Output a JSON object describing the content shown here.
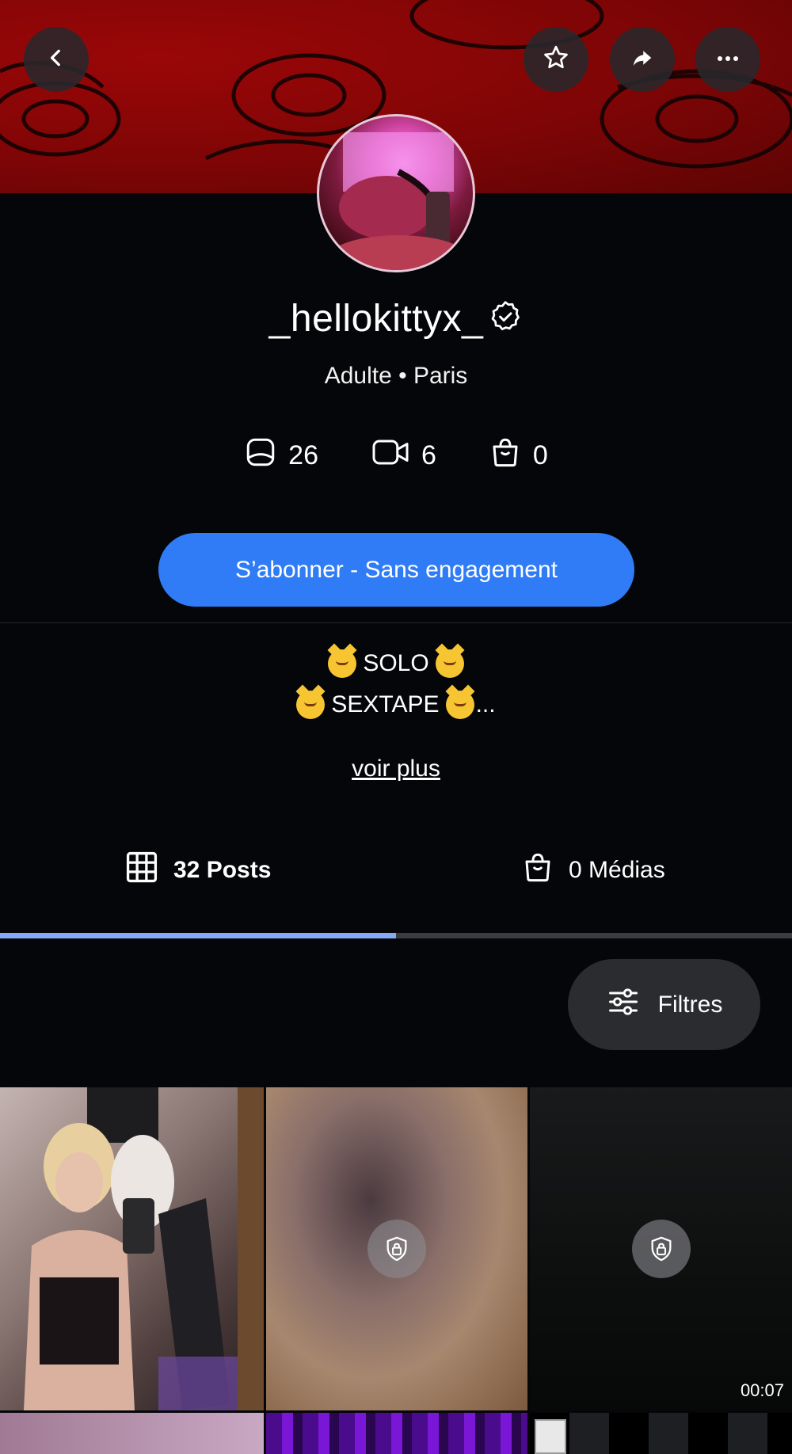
{
  "header": {
    "back_icon": "chevron-left-icon",
    "favorite_icon": "star-icon",
    "share_icon": "share-arrow-icon",
    "more_icon": "ellipsis-icon"
  },
  "profile": {
    "username": "_hellokittyx_",
    "verified_icon": "verified-badge-icon",
    "subtitle": "Adulte • Paris",
    "stats": [
      {
        "icon": "photo-icon",
        "value": "26"
      },
      {
        "icon": "video-icon",
        "value": "6"
      },
      {
        "icon": "shopping-bag-icon",
        "value": "0"
      }
    ]
  },
  "subscribe": {
    "label": "S’abonner - Sans engagement",
    "color": "#2f7cf6"
  },
  "bio": {
    "line1": "SOLO",
    "line2": "SEXTAPE",
    "line2_suffix": "...",
    "more_link": "voir plus"
  },
  "tabs": [
    {
      "icon": "grid-icon",
      "label": "32 Posts",
      "active": true
    },
    {
      "icon": "shopping-bag-icon",
      "label": "0 Médias",
      "active": false
    }
  ],
  "filters": {
    "label": "Filtres",
    "icon": "sliders-icon"
  },
  "grid": {
    "items": [
      {
        "type": "photo",
        "locked": false
      },
      {
        "type": "photo",
        "locked": true
      },
      {
        "type": "video",
        "locked": true,
        "duration": "00:07"
      }
    ]
  },
  "colors": {
    "accent": "#2f7cf6",
    "background": "#05060a",
    "tab_indicator": "#85a9f5",
    "banner": "#8a0607"
  }
}
